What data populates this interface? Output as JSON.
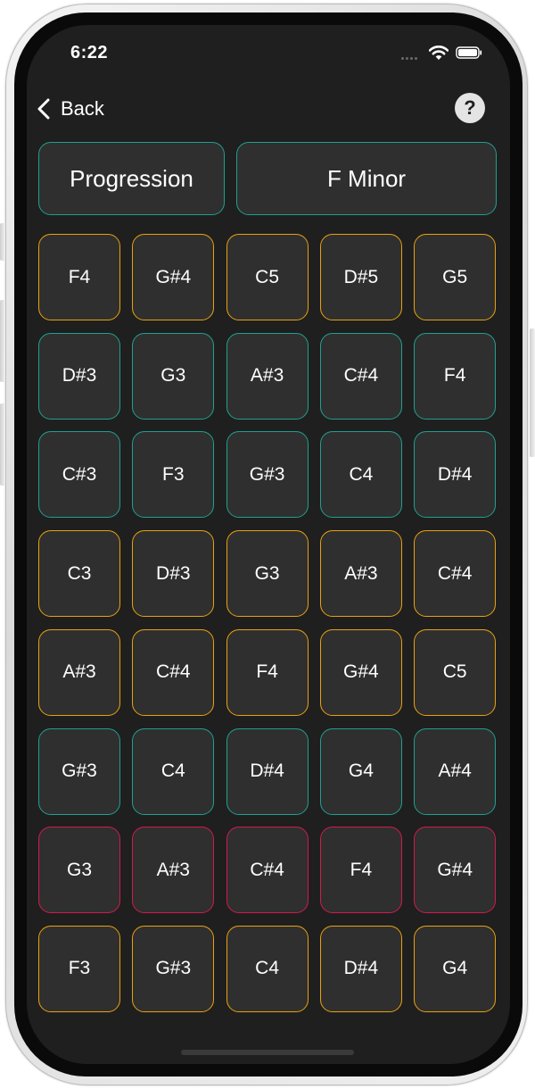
{
  "status_bar": {
    "time": "6:22",
    "wifi_icon": "wifi-icon",
    "battery_icon": "battery-icon"
  },
  "nav": {
    "back_label": "Back",
    "help_label": "?"
  },
  "header": {
    "mode_label": "Progression",
    "key_label": "F Minor",
    "border_color": "#1fa08f"
  },
  "colors": {
    "orange": "#e9a10f",
    "teal": "#1fa08f",
    "red": "#d21a4d",
    "pad_bg": "#2f2f2f",
    "screen_bg": "#1f1f1f"
  },
  "grid": {
    "rows": [
      {
        "color": "orange",
        "notes": [
          "F4",
          "G#4",
          "C5",
          "D#5",
          "G5"
        ]
      },
      {
        "color": "teal",
        "notes": [
          "D#3",
          "G3",
          "A#3",
          "C#4",
          "F4"
        ]
      },
      {
        "color": "teal",
        "notes": [
          "C#3",
          "F3",
          "G#3",
          "C4",
          "D#4"
        ]
      },
      {
        "color": "orange",
        "notes": [
          "C3",
          "D#3",
          "G3",
          "A#3",
          "C#4"
        ]
      },
      {
        "color": "orange",
        "notes": [
          "A#3",
          "C#4",
          "F4",
          "G#4",
          "C5"
        ]
      },
      {
        "color": "teal",
        "notes": [
          "G#3",
          "C4",
          "D#4",
          "G4",
          "A#4"
        ]
      },
      {
        "color": "red",
        "notes": [
          "G3",
          "A#3",
          "C#4",
          "F4",
          "G#4"
        ]
      },
      {
        "color": "orange",
        "notes": [
          "F3",
          "G#3",
          "C4",
          "D#4",
          "G4"
        ]
      }
    ]
  }
}
